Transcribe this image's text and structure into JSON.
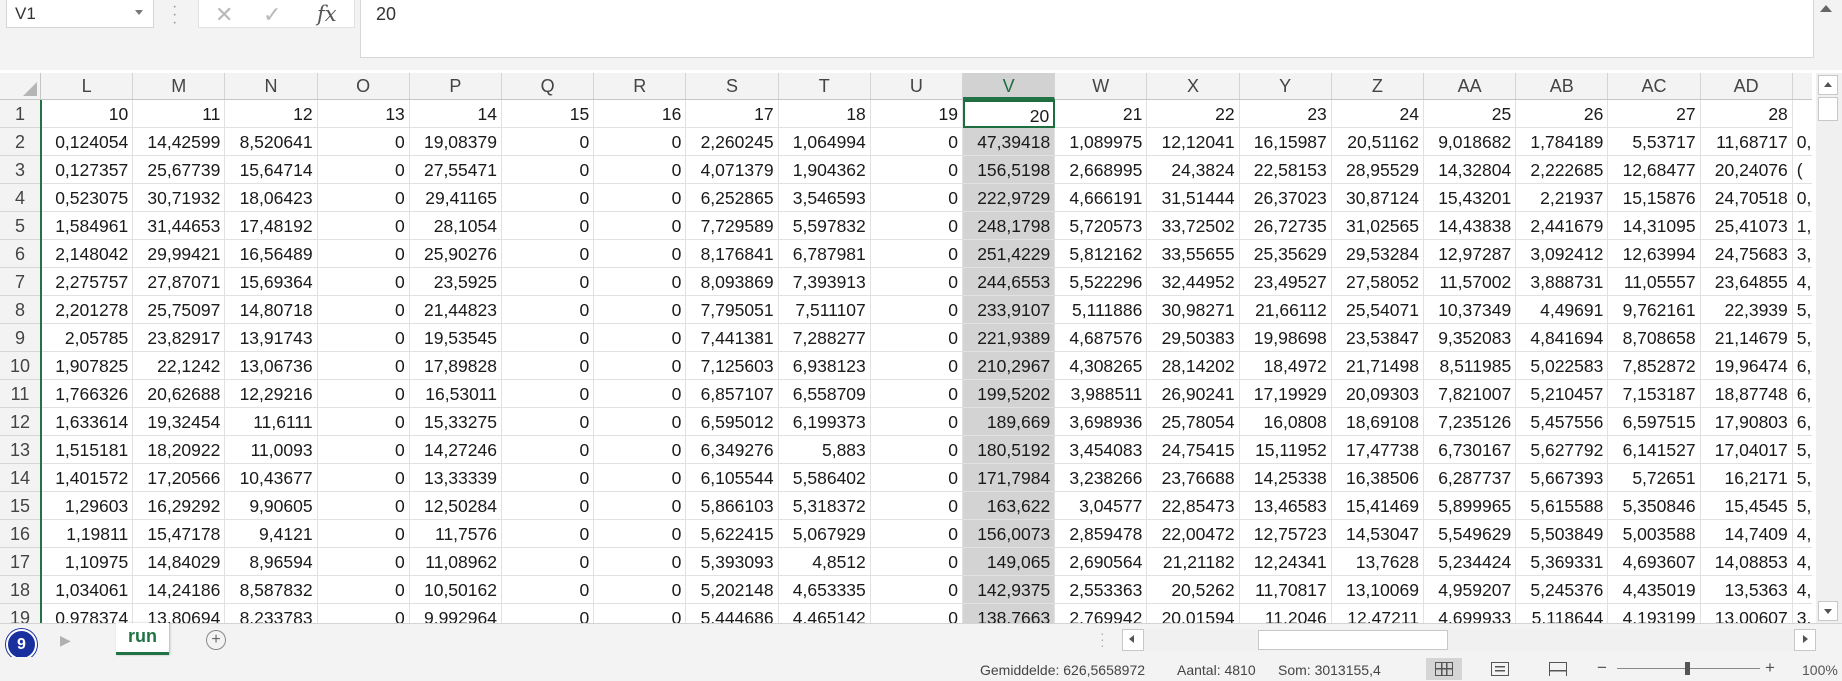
{
  "name_box": {
    "value": "V1"
  },
  "formula_bar": {
    "cancel_glyph": "✕",
    "enter_glyph": "✓",
    "fx_label": "fx",
    "value": "20"
  },
  "grid": {
    "columns": [
      "L",
      "M",
      "N",
      "O",
      "P",
      "Q",
      "R",
      "S",
      "T",
      "U",
      "V",
      "W",
      "X",
      "Y",
      "Z",
      "AA",
      "AB",
      "AC",
      "AD"
    ],
    "selected_column": "V",
    "active_cell": "V1",
    "rows": [
      {
        "n": "1",
        "cells": [
          "10",
          "11",
          "12",
          "13",
          "14",
          "15",
          "16",
          "17",
          "18",
          "19",
          "20",
          "21",
          "22",
          "23",
          "24",
          "25",
          "26",
          "27",
          "28"
        ]
      },
      {
        "n": "2",
        "cells": [
          "0,124054",
          "14,42599",
          "8,520641",
          "0",
          "19,08379",
          "0",
          "0",
          "2,260245",
          "1,064994",
          "0",
          "47,39418",
          "1,089975",
          "12,12041",
          "16,15987",
          "20,51162",
          "9,018682",
          "1,784189",
          "5,53717",
          "11,68717"
        ]
      },
      {
        "n": "3",
        "cells": [
          "0,127357",
          "25,67739",
          "15,64714",
          "0",
          "27,55471",
          "0",
          "0",
          "4,071379",
          "1,904362",
          "0",
          "156,5198",
          "2,668995",
          "24,3824",
          "22,58153",
          "28,95529",
          "14,32804",
          "2,222685",
          "12,68477",
          "20,24076"
        ]
      },
      {
        "n": "4",
        "cells": [
          "0,523075",
          "30,71932",
          "18,06423",
          "0",
          "29,41165",
          "0",
          "0",
          "6,252865",
          "3,546593",
          "0",
          "222,9729",
          "4,666191",
          "31,51444",
          "26,37023",
          "30,87124",
          "15,43201",
          "2,21937",
          "15,15876",
          "24,70518"
        ]
      },
      {
        "n": "5",
        "cells": [
          "1,584961",
          "31,44653",
          "17,48192",
          "0",
          "28,1054",
          "0",
          "0",
          "7,729589",
          "5,597832",
          "0",
          "248,1798",
          "5,720573",
          "33,72502",
          "26,72735",
          "31,02565",
          "14,43838",
          "2,441679",
          "14,31095",
          "25,41073"
        ]
      },
      {
        "n": "6",
        "cells": [
          "2,148042",
          "29,99421",
          "16,56489",
          "0",
          "25,90276",
          "0",
          "0",
          "8,176841",
          "6,787981",
          "0",
          "251,4229",
          "5,812162",
          "33,55655",
          "25,35629",
          "29,53284",
          "12,97287",
          "3,092412",
          "12,63994",
          "24,75683"
        ]
      },
      {
        "n": "7",
        "cells": [
          "2,275757",
          "27,87071",
          "15,69364",
          "0",
          "23,5925",
          "0",
          "0",
          "8,093869",
          "7,393913",
          "0",
          "244,6553",
          "5,522296",
          "32,44952",
          "23,49527",
          "27,58052",
          "11,57002",
          "3,888731",
          "11,05557",
          "23,64855"
        ]
      },
      {
        "n": "8",
        "cells": [
          "2,201278",
          "25,75097",
          "14,80718",
          "0",
          "21,44823",
          "0",
          "0",
          "7,795051",
          "7,511107",
          "0",
          "233,9107",
          "5,111886",
          "30,98271",
          "21,66112",
          "25,54071",
          "10,37349",
          "4,49691",
          "9,762161",
          "22,3939"
        ]
      },
      {
        "n": "9",
        "cells": [
          "2,05785",
          "23,82917",
          "13,91743",
          "0",
          "19,53545",
          "0",
          "0",
          "7,441381",
          "7,288277",
          "0",
          "221,9389",
          "4,687576",
          "29,50383",
          "19,98698",
          "23,53847",
          "9,352083",
          "4,841694",
          "8,708658",
          "21,14679"
        ]
      },
      {
        "n": "10",
        "cells": [
          "1,907825",
          "22,1242",
          "13,06736",
          "0",
          "17,89828",
          "0",
          "0",
          "7,125603",
          "6,938123",
          "0",
          "210,2967",
          "4,308265",
          "28,14202",
          "18,4972",
          "21,71498",
          "8,511985",
          "5,022583",
          "7,852872",
          "19,96474"
        ]
      },
      {
        "n": "11",
        "cells": [
          "1,766326",
          "20,62688",
          "12,29216",
          "0",
          "16,53011",
          "0",
          "0",
          "6,857107",
          "6,558709",
          "0",
          "199,5202",
          "3,988511",
          "26,90241",
          "17,19929",
          "20,09303",
          "7,821007",
          "5,210457",
          "7,153187",
          "18,87748"
        ]
      },
      {
        "n": "12",
        "cells": [
          "1,633614",
          "19,32454",
          "11,6111",
          "0",
          "15,33275",
          "0",
          "0",
          "6,595012",
          "6,199373",
          "0",
          "189,669",
          "3,698936",
          "25,78054",
          "16,0808",
          "18,69108",
          "7,235126",
          "5,457556",
          "6,597515",
          "17,90803"
        ]
      },
      {
        "n": "13",
        "cells": [
          "1,515181",
          "18,20922",
          "11,0093",
          "0",
          "14,27246",
          "0",
          "0",
          "6,349276",
          "5,883",
          "0",
          "180,5192",
          "3,454083",
          "24,75415",
          "15,11952",
          "17,47738",
          "6,730167",
          "5,627792",
          "6,141527",
          "17,04017"
        ]
      },
      {
        "n": "14",
        "cells": [
          "1,401572",
          "17,20566",
          "10,43677",
          "0",
          "13,33339",
          "0",
          "0",
          "6,105544",
          "5,586402",
          "0",
          "171,7984",
          "3,238266",
          "23,76688",
          "14,25338",
          "16,38506",
          "6,287737",
          "5,667393",
          "5,72651",
          "16,2171"
        ]
      },
      {
        "n": "15",
        "cells": [
          "1,29603",
          "16,29292",
          "9,90605",
          "0",
          "12,50284",
          "0",
          "0",
          "5,866103",
          "5,318372",
          "0",
          "163,622",
          "3,04577",
          "22,85473",
          "13,46583",
          "15,41469",
          "5,899965",
          "5,615588",
          "5,350846",
          "15,4545"
        ]
      },
      {
        "n": "16",
        "cells": [
          "1,19811",
          "15,47178",
          "9,4121",
          "0",
          "11,7576",
          "0",
          "0",
          "5,622415",
          "5,067929",
          "0",
          "156,0073",
          "2,859478",
          "22,00472",
          "12,75723",
          "14,53047",
          "5,549629",
          "5,503849",
          "5,003588",
          "14,7409"
        ]
      },
      {
        "n": "17",
        "cells": [
          "1,10975",
          "14,84029",
          "8,96594",
          "0",
          "11,08962",
          "0",
          "0",
          "5,393093",
          "4,8512",
          "0",
          "149,065",
          "2,690564",
          "21,21182",
          "12,24341",
          "13,7628",
          "5,234424",
          "5,369331",
          "4,693607",
          "14,08853"
        ]
      },
      {
        "n": "18",
        "cells": [
          "1,034061",
          "14,24186",
          "8,587832",
          "0",
          "10,50162",
          "0",
          "0",
          "5,202148",
          "4,653335",
          "0",
          "142,9375",
          "2,553363",
          "20,5262",
          "11,70817",
          "13,10069",
          "4,959207",
          "5,245376",
          "4,435019",
          "13,5363"
        ]
      },
      {
        "n": "19",
        "cells": [
          "0,978374",
          "13,80694",
          "8,233783",
          "0",
          "9,992964",
          "0",
          "0",
          "5,444686",
          "4,465142",
          "0",
          "138,7663",
          "2,769942",
          "20,01594",
          "11,2046",
          "12,47211",
          "4,699933",
          "5,118644",
          "4,193199",
          "13,00607"
        ]
      }
    ],
    "overflow_col": [
      "0,",
      "(",
      "0,",
      "1,",
      "3,",
      "4,",
      "5,",
      "5,",
      "6,",
      "6,",
      "6,",
      "5,",
      "5,",
      "5,",
      "4,",
      "4,",
      "4,",
      "3,"
    ]
  },
  "sheet_tabs": {
    "badge": "9",
    "next_glyph": "▶",
    "active_sheet": "run",
    "add_glyph": "+"
  },
  "status_bar": {
    "average": "Gemiddelde: 626,5658972",
    "count": "Aantal: 4810",
    "sum": "Som: 3013155,4",
    "zoom_minus": "−",
    "zoom_plus": "+",
    "zoom_level": "100%"
  }
}
